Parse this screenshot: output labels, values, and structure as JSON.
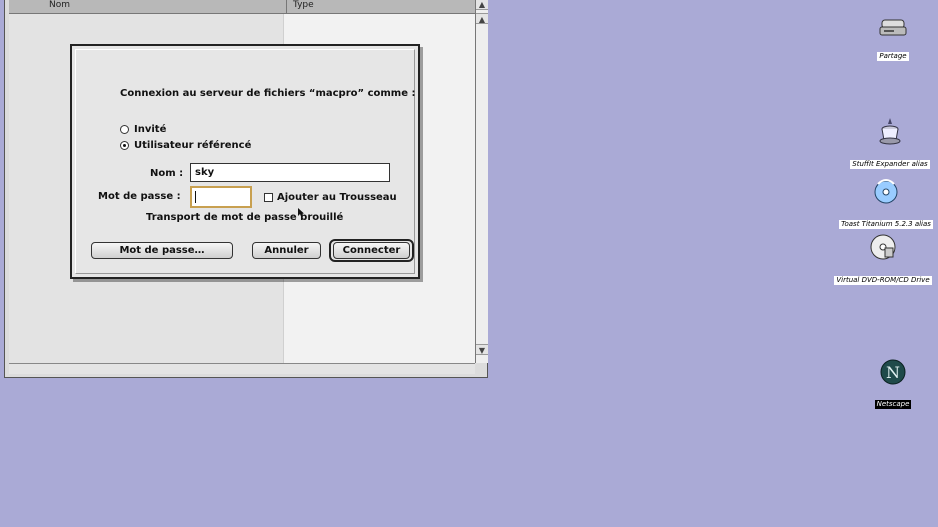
{
  "finder_window": {
    "columns": {
      "name": "Nom",
      "type": "Type"
    },
    "scroll_up_glyph": "▲",
    "scroll_down_glyph": "▼"
  },
  "connect_dialog": {
    "prompt": "Connexion au serveur de fichiers “macpro” comme :",
    "options": [
      {
        "label": "Invité",
        "selected": false
      },
      {
        "label": "Utilisateur référencé",
        "selected": true
      }
    ],
    "name_label": "Nom :",
    "name_value": "sky",
    "password_label": "Mot de passe :",
    "password_value": "",
    "keychain_label": "Ajouter au Trousseau",
    "keychain_checked": false,
    "transport_note": "Transport de mot de passe brouillé",
    "buttons": {
      "password": "Mot de passe…",
      "cancel": "Annuler",
      "connect": "Connecter"
    }
  },
  "desktop_icons": [
    {
      "label": "Partage",
      "icon": "server-icon"
    },
    {
      "label": "StuffIt Expander alias",
      "icon": "stuffit-icon"
    },
    {
      "label": "Toast Titanium 5.2.3 alias",
      "icon": "toast-icon"
    },
    {
      "label": "Virtual DVD-ROM/CD Drive",
      "icon": "disc-icon"
    },
    {
      "label": "Netscape",
      "icon": "netscape-icon"
    }
  ],
  "colors": {
    "desktop": "#aaaad6",
    "focus_ring": "#c8a050"
  }
}
